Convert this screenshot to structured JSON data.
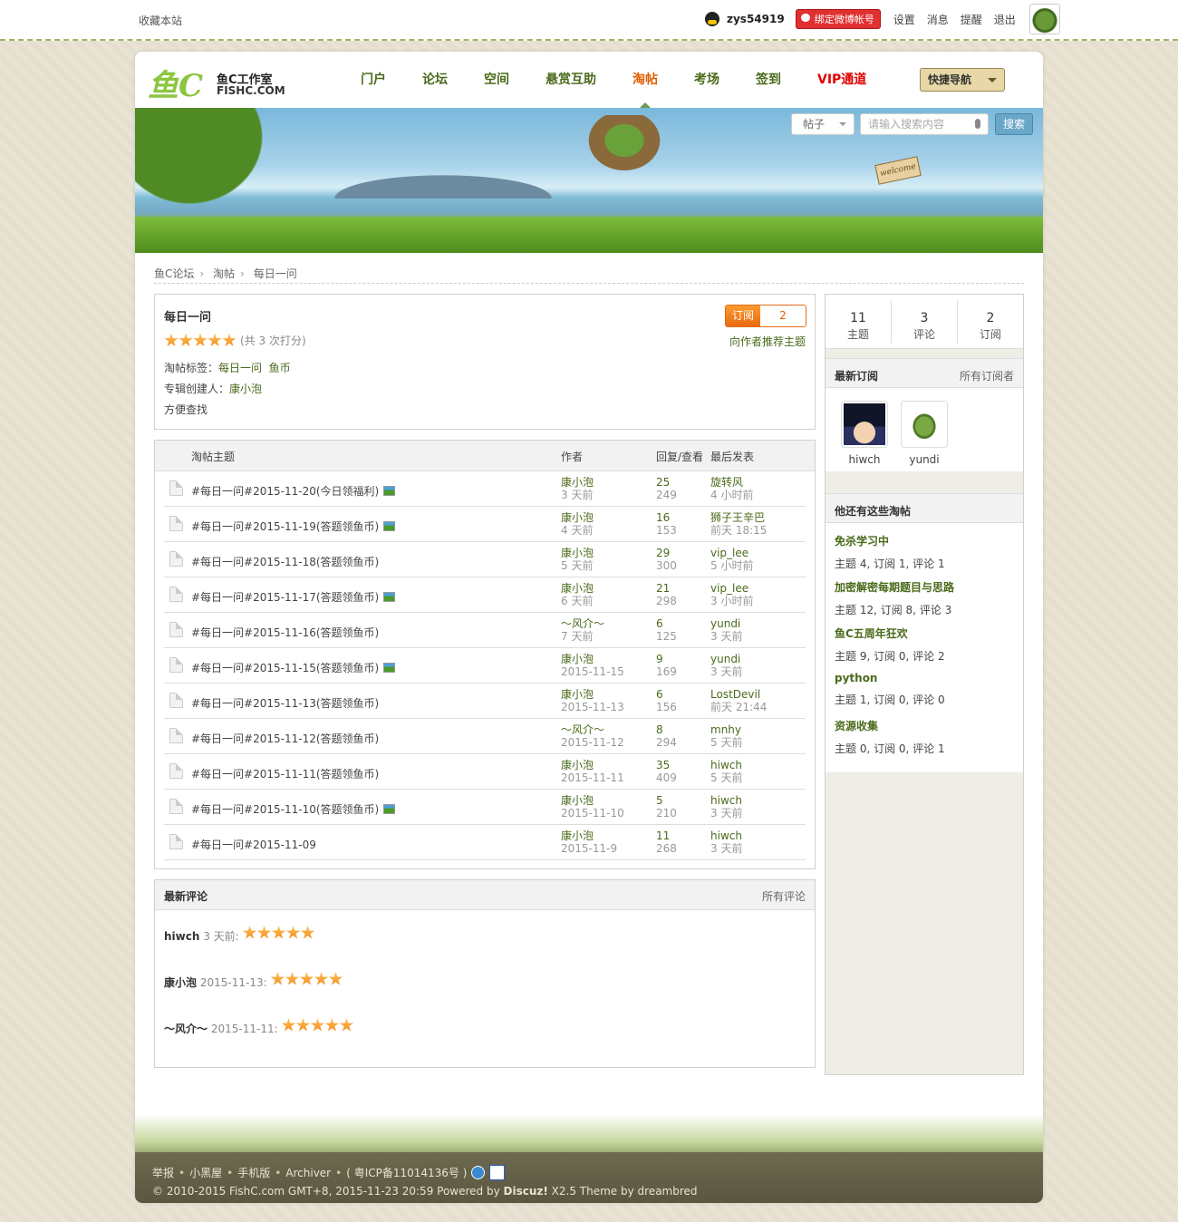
{
  "topbar": {
    "favorite": "收藏本站",
    "username": "zys54919",
    "weibo_bind": "绑定微博帐号",
    "links": [
      "设置",
      "消息",
      "提醒",
      "退出"
    ]
  },
  "header": {
    "logo_big": "鱼C",
    "logo_cn": "鱼C工作室",
    "logo_en": "FISHC.COM",
    "nav": [
      "门户",
      "论坛",
      "空间",
      "悬赏互助",
      "淘帖",
      "考场",
      "签到",
      "VIP通道"
    ],
    "quick_nav": "快捷导航"
  },
  "banner": {
    "welcome": "welcome"
  },
  "search": {
    "type": "帖子",
    "placeholder": "请输入搜索内容",
    "button": "搜索"
  },
  "breadcrumb": [
    "鱼C论坛",
    "淘帖",
    "每日一问"
  ],
  "collection": {
    "title": "每日一问",
    "rating_count": "(共 3 次打分)",
    "stars": 5,
    "subscribe_label": "订阅",
    "subscribe_count": "2",
    "recommend": "向作者推荐主题",
    "tags_label": "淘帖标签：",
    "tags": [
      "每日一问",
      "鱼币"
    ],
    "creator_label": "专辑创建人：",
    "creator": "康小泡",
    "description": "方便查找"
  },
  "table": {
    "headers": {
      "topic": "淘帖主题",
      "author": "作者",
      "replies": "回复/查看",
      "last": "最后发表"
    },
    "rows": [
      {
        "title": "#每日一问#2015-11-20(今日领福利)",
        "img": true,
        "author": "康小泡",
        "date": "3 天前",
        "replies": "25",
        "views": "249",
        "last_user": "旋转风",
        "last_time": "4 小时前"
      },
      {
        "title": "#每日一问#2015-11-19(答题领鱼币)",
        "img": true,
        "author": "康小泡",
        "date": "4 天前",
        "replies": "16",
        "views": "153",
        "last_user": "狮子王辛巴",
        "last_time": "前天 18:15"
      },
      {
        "title": "#每日一问#2015-11-18(答题领鱼币)",
        "img": false,
        "author": "康小泡",
        "date": "5 天前",
        "replies": "29",
        "views": "300",
        "last_user": "vip_lee",
        "last_time": "5 小时前"
      },
      {
        "title": "#每日一问#2015-11-17(答题领鱼币)",
        "img": true,
        "author": "康小泡",
        "date": "6 天前",
        "replies": "21",
        "views": "298",
        "last_user": "vip_lee",
        "last_time": "3 小时前"
      },
      {
        "title": "#每日一问#2015-11-16(答题领鱼币)",
        "img": false,
        "author": "～风介～",
        "date": "7 天前",
        "replies": "6",
        "views": "125",
        "last_user": "yundi",
        "last_time": "3 天前"
      },
      {
        "title": "#每日一问#2015-11-15(答题领鱼币)",
        "img": true,
        "author": "康小泡",
        "date": "2015-11-15",
        "replies": "9",
        "views": "169",
        "last_user": "yundi",
        "last_time": "3 天前"
      },
      {
        "title": "#每日一问#2015-11-13(答题领鱼币)",
        "img": false,
        "author": "康小泡",
        "date": "2015-11-13",
        "replies": "6",
        "views": "156",
        "last_user": "LostDevil",
        "last_time": "前天 21:44"
      },
      {
        "title": "#每日一问#2015-11-12(答题领鱼币)",
        "img": false,
        "author": "～风介～",
        "date": "2015-11-12",
        "replies": "8",
        "views": "294",
        "last_user": "mnhy",
        "last_time": "5 天前"
      },
      {
        "title": "#每日一问#2015-11-11(答题领鱼币)",
        "img": false,
        "author": "康小泡",
        "date": "2015-11-11",
        "replies": "35",
        "views": "409",
        "last_user": "hiwch",
        "last_time": "5 天前"
      },
      {
        "title": "#每日一问#2015-11-10(答题领鱼币)",
        "img": true,
        "author": "康小泡",
        "date": "2015-11-10",
        "replies": "5",
        "views": "210",
        "last_user": "hiwch",
        "last_time": "3 天前"
      },
      {
        "title": "#每日一问#2015-11-09",
        "img": false,
        "author": "康小泡",
        "date": "2015-11-9",
        "replies": "11",
        "views": "268",
        "last_user": "hiwch",
        "last_time": "3 天前"
      }
    ]
  },
  "comments": {
    "title": "最新评论",
    "all": "所有评论",
    "items": [
      {
        "who": "hiwch",
        "when": "3 天前:",
        "stars": 5
      },
      {
        "who": "康小泡",
        "when": "2015-11-13:",
        "stars": 5
      },
      {
        "who": "～风介～",
        "when": "2015-11-11:",
        "stars": 5
      }
    ]
  },
  "sidebar": {
    "stats": [
      {
        "n": "11",
        "k": "主题"
      },
      {
        "n": "3",
        "k": "评论"
      },
      {
        "n": "2",
        "k": "订阅"
      }
    ],
    "latest_title": "最新订阅",
    "latest_all": "所有订阅者",
    "subscribers": [
      "hiwch",
      "yundi"
    ],
    "others_title": "他还有这些淘帖",
    "others": [
      {
        "name": "免杀学习中",
        "stat": "主题 4, 订阅 1, 评论 1"
      },
      {
        "name": "加密解密每期题目与思路",
        "stat": "主题 12, 订阅 8, 评论 3"
      },
      {
        "name": "鱼C五周年狂欢",
        "stat": "主题 9, 订阅 0, 评论 2"
      },
      {
        "name": "python",
        "stat": "主题 1, 订阅 0, 评论 0"
      },
      {
        "name": "资源收集",
        "stat": "主题 0, 订阅 0, 评论 1"
      }
    ]
  },
  "footer": {
    "links": [
      "举报",
      "小黑屋",
      "手机版",
      "Archiver",
      "( 粤ICP备11014136号 )"
    ],
    "copyright_pre": "© 2010-2015 FishC.com GMT+8, 2015-11-23 20:59 Powered by ",
    "discuz": "Discuz!",
    "copyright_post": " X2.5   Theme by dreambred"
  }
}
